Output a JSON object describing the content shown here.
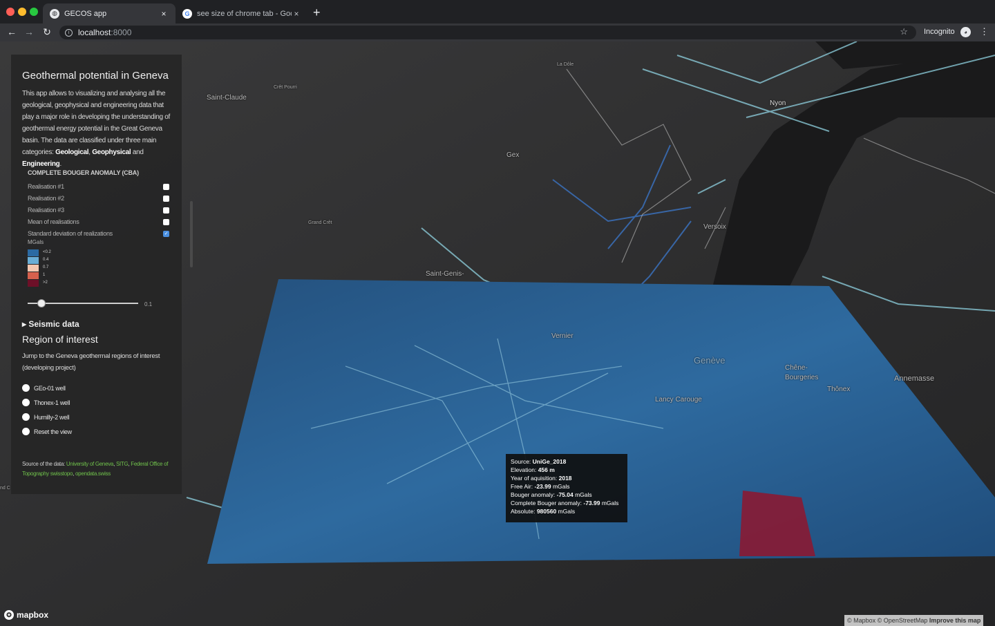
{
  "browser": {
    "tabs": [
      {
        "title": "GECOS app",
        "close": "×"
      },
      {
        "title": "see size of chrome tab - Googl",
        "close": "×"
      }
    ],
    "new_tab": "+",
    "url_host": "localhost",
    "url_port": ":8000",
    "incognito_label": "Incognito"
  },
  "map": {
    "places": {
      "la_dole": "La Dôle",
      "saint_claude": "Saint-Claude",
      "cret_pourri": "Crêt Pourri",
      "nyon": "Nyon",
      "gex": "Gex",
      "grand_cret": "Grand Crêt",
      "versoix": "Versoix",
      "saint_genis": "Saint-Genis-",
      "vernier": "Vernier",
      "geneve": "Genève",
      "chene_bourgeries": "Chêne-Bourgeries",
      "thonex": "Thônex",
      "annemasse": "Annemasse",
      "lancy_carouge": "Lancy Carouge",
      "edge_label": "nd C"
    },
    "colors": {
      "low": "#2b6aa3",
      "mid_low": "#6aaed6",
      "mid": "#f4c7b0",
      "mid_high": "#d6604d",
      "high": "#8a1a33",
      "lake": "#1a1a1b",
      "road": "#8fd1e0"
    }
  },
  "panel": {
    "title": "Geothermal potential in Geneva",
    "description_prefix": "This app allows to visualizing and analysing all the geological, geophysical and engineering data that play a major role in developing the understanding of geothermal energy potential in the Great Geneva basin. The data are classified under three main categories: ",
    "cat_geological": "Geological",
    "sep1": ", ",
    "cat_geophysical": "Geophysical",
    "sep2": " and ",
    "cat_engineering": "Engineering",
    "sep3": ".",
    "cba_heading": "COMPLETE BOUGER ANOMALY (CBA)",
    "cba_layers": [
      {
        "label": "Realisation #1",
        "checked": false
      },
      {
        "label": "Realisation #2",
        "checked": false
      },
      {
        "label": "Realisation #3",
        "checked": false
      },
      {
        "label": "Mean of realisations",
        "checked": false
      },
      {
        "label": "Standard deviation of realizations",
        "checked": true
      }
    ],
    "units": "MGals",
    "legend": [
      {
        "label": "<0.2",
        "color": "#2b6aa3"
      },
      {
        "label": "0.4",
        "color": "#6aaed6"
      },
      {
        "label": "0.7",
        "color": "#f4c7b0"
      },
      {
        "label": "1",
        "color": "#d6604d"
      },
      {
        "label": ">2",
        "color": "#6d1028"
      }
    ],
    "opacity_value": "0.1",
    "seismic_label": "Seismic data",
    "region_title": "Region of interest",
    "region_desc": "Jump to the Geneva geothermal regions of interest (developing project)",
    "regions": [
      {
        "label": "GEo-01 well"
      },
      {
        "label": "Thonex-1 well"
      },
      {
        "label": "Humilly-2 well"
      },
      {
        "label": "Reset the view"
      }
    ],
    "source_prefix": "Source of the data: ",
    "sources": [
      "University of Geneva",
      "SITG",
      "Federal Office of Topography swisstopo",
      "opendata.swiss"
    ],
    "source_seps": [
      ", ",
      ", ",
      ", "
    ]
  },
  "tooltip": {
    "source_label": "Source: ",
    "source_value": "UniGe_2018",
    "elevation_label": "Elevation: ",
    "elevation_value": "456 m",
    "year_label": "Year of aquisition: ",
    "year_value": "2018",
    "freeair_label": "Free Air: ",
    "freeair_value": "-23.99",
    "freeair_unit": " mGals",
    "bouger_label": "Bouger anomaly: ",
    "bouger_value": "-75.04",
    "bouger_unit": " mGals",
    "cba_label": "Complete Bouger anomaly: ",
    "cba_value": "-73.99",
    "cba_unit": " mGals",
    "absolute_label": "Absolute: ",
    "absolute_value": "980560",
    "absolute_unit": " mGals"
  },
  "footer": {
    "mapbox": "mapbox",
    "attrib_mapbox": "© Mapbox",
    "attrib_osm": "© OpenStreetMap",
    "improve": "Improve this map"
  }
}
